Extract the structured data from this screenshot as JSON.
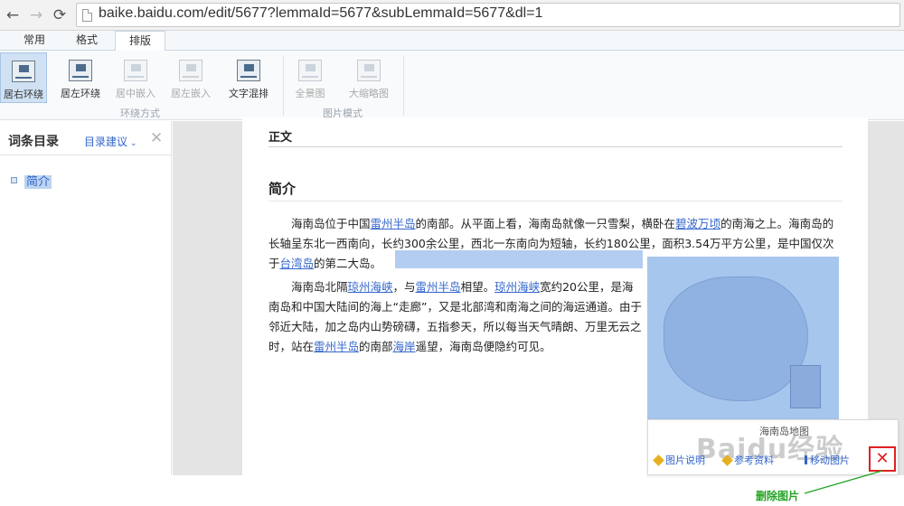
{
  "browser": {
    "url": "baike.baidu.com/edit/5677?lemmaId=5677&subLemmaId=5677&dl=1",
    "back_icon": "back-arrow-icon",
    "forward_icon": "forward-arrow-icon",
    "reload_icon": "reload-icon"
  },
  "ribbon": {
    "tabs": [
      "常用",
      "格式",
      "排版"
    ],
    "active_tab": "排版",
    "buttons": [
      "居右环绕",
      "居左环绕",
      "居中嵌入",
      "居左嵌入",
      "文字混排",
      "全景图",
      "大缩略图"
    ],
    "groups": [
      "环绕方式",
      "图片模式"
    ]
  },
  "sidebar": {
    "title": "词条目录",
    "suggest": "目录建议",
    "close": "✕",
    "items": [
      "简介"
    ]
  },
  "doc": {
    "heading": "正文",
    "section": "简介",
    "para1": {
      "t1": "海南岛位于中国",
      "l1": "雷州半岛",
      "t2": "的南部。从平面上看，海南岛就像一只雪梨，横卧在",
      "l2": "碧波万顷",
      "t3": "的南海之上。海南岛的长轴呈东北一西南向，长约300余公里，西北一东南向为短轴，长约180公里，面积3.54万平方公里，是中国仅次于",
      "l3": "台湾岛",
      "t4": "的第二大岛。"
    },
    "para2": {
      "t1": "海南岛北隔",
      "l1": "琼州海峡",
      "t2": "，与",
      "l2": "雷州半岛",
      "t3": "相望。",
      "l3": "琼州海峡",
      "t4": "宽约20公里，是海南岛和中国大陆间的海上“走廊”，又是北部湾和南海之间的海运通道。由于邻近大陆，加之岛内山势磅礴，五指参天，所以每当天气晴朗、万里无云之时，站在",
      "l4": "雷州半岛",
      "t5": "的南部",
      "l5": "海岸",
      "t6": "遥望，海南岛便隐约可见。"
    }
  },
  "image": {
    "caption": "海南岛地图",
    "tools": [
      "图片说明",
      "参考资料",
      "移动图片"
    ],
    "delete_icon": "✕",
    "delete_label": "删除图片"
  },
  "watermark": "Baidu经验",
  "colors": {
    "link": "#3366cc",
    "delete": "#e02020",
    "callout": "#22a322"
  }
}
